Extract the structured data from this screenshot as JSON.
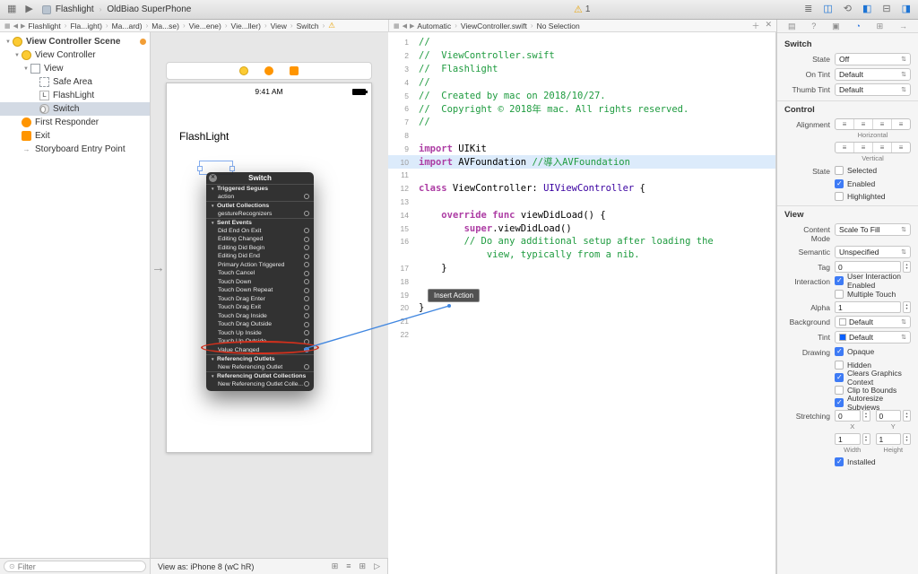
{
  "icons": {
    "chevron": "›",
    "back": "◀",
    "forward": "▶",
    "related": "▦",
    "warning": "⚠",
    "disclosure_down": "▼",
    "entry_arrow": "→",
    "close": "✕",
    "add": "＋",
    "dd_arrows": "⇅",
    "stepper_up": "▲",
    "stepper_down": "▼",
    "filter": "⊙",
    "seg": "≡",
    "list": "≣",
    "assistant": "◫",
    "version": "⟲",
    "navigator": "◧",
    "debug": "⊟",
    "inspector_panel": "◨",
    "tab_file": "▤",
    "tab_help": "?",
    "tab_identity": "▣",
    "tab_attributes": "◔",
    "tab_size": "⊞",
    "tab_connections": "→",
    "stack": "⊞",
    "align": "≡",
    "pin": "⊞",
    "resolve": "▷",
    "window": "▦",
    "play": "▶",
    "label_glyph": "L",
    "close_x": "✕"
  },
  "toolbar": {
    "scheme": "Flashlight",
    "device": "OldBiao SuperPhone",
    "warning_count": "1",
    "right_icons": [
      {
        "name": "editor-list-icon",
        "glyph": "list",
        "active": false
      },
      {
        "name": "assistant-editor-icon",
        "glyph": "assistant",
        "active": true
      },
      {
        "name": "version-editor-icon",
        "glyph": "version",
        "active": false
      },
      {
        "name": "navigator-panel-toggle",
        "glyph": "navigator",
        "active": true
      },
      {
        "name": "debug-panel-toggle",
        "glyph": "debug",
        "active": false
      },
      {
        "name": "inspector-panel-toggle",
        "glyph": "inspector_panel",
        "active": true
      }
    ]
  },
  "ib_jumpbar": {
    "items": [
      "Flashlight",
      "Fla...ight)",
      "Ma...ard)",
      "Ma...se)",
      "Vie...ene)",
      "Vie...ller)",
      "View",
      "Switch"
    ],
    "has_warning": true
  },
  "code_jumpbar": {
    "items": [
      "Automatic",
      "ViewController.swift",
      "No Selection"
    ]
  },
  "outline": {
    "scene_title": "View Controller Scene",
    "filter_placeholder": "Filter",
    "items": [
      {
        "label": "View Controller",
        "depth": 1,
        "icon": "vc",
        "disclosure": true
      },
      {
        "label": "View",
        "depth": 2,
        "icon": "view",
        "disclosure": true
      },
      {
        "label": "Safe Area",
        "depth": 3,
        "icon": "safearea"
      },
      {
        "label": "FlashLight",
        "depth": 3,
        "icon": "label"
      },
      {
        "label": "Switch",
        "depth": 3,
        "icon": "switch",
        "selected": true
      },
      {
        "label": "First Responder",
        "depth": 1,
        "icon": "fr"
      },
      {
        "label": "Exit",
        "depth": 1,
        "icon": "exit"
      },
      {
        "label": "Storyboard Entry Point",
        "depth": 1,
        "icon": "entry"
      }
    ]
  },
  "canvas": {
    "status_time": "9:41 AM",
    "app_label": "FlashLight",
    "view_as": "View as: iPhone 8 (wC hR)",
    "bottom_icons": [
      {
        "name": "embed-in-stack-button",
        "glyph": "stack"
      },
      {
        "name": "align-button",
        "glyph": "align"
      },
      {
        "name": "add-constraints-button",
        "glyph": "pin"
      },
      {
        "name": "resolve-autolayout-button",
        "glyph": "resolve"
      }
    ]
  },
  "hud": {
    "title": "Switch",
    "rows": [
      {
        "type": "section",
        "label": "Triggered Segues"
      },
      {
        "type": "item",
        "label": "action"
      },
      {
        "type": "section",
        "label": "Outlet Collections"
      },
      {
        "type": "item",
        "label": "gestureRecognizers"
      },
      {
        "type": "section",
        "label": "Sent Events"
      },
      {
        "type": "item",
        "label": "Did End On Exit"
      },
      {
        "type": "item",
        "label": "Editing Changed"
      },
      {
        "type": "item",
        "label": "Editing Did Begin"
      },
      {
        "type": "item",
        "label": "Editing Did End"
      },
      {
        "type": "item",
        "label": "Primary Action Triggered"
      },
      {
        "type": "item",
        "label": "Touch Cancel"
      },
      {
        "type": "item",
        "label": "Touch Down"
      },
      {
        "type": "item",
        "label": "Touch Down Repeat"
      },
      {
        "type": "item",
        "label": "Touch Drag Enter"
      },
      {
        "type": "item",
        "label": "Touch Drag Exit"
      },
      {
        "type": "item",
        "label": "Touch Drag Inside"
      },
      {
        "type": "item",
        "label": "Touch Drag Outside"
      },
      {
        "type": "item",
        "label": "Touch Up Inside"
      },
      {
        "type": "item",
        "label": "Touch Up Outside"
      },
      {
        "type": "item",
        "label": "Value Changed",
        "connected": true
      },
      {
        "type": "section",
        "label": "Referencing Outlets"
      },
      {
        "type": "item",
        "label": "New Referencing Outlet"
      },
      {
        "type": "section",
        "label": "Referencing Outlet Collections"
      },
      {
        "type": "item",
        "label": "New Referencing Outlet Colle..."
      }
    ]
  },
  "code": {
    "tooltip": "Insert Action",
    "lines": [
      {
        "n": "1",
        "seg": [
          [
            "com",
            "//"
          ]
        ]
      },
      {
        "n": "2",
        "seg": [
          [
            "com",
            "//  ViewController.swift"
          ]
        ]
      },
      {
        "n": "3",
        "seg": [
          [
            "com",
            "//  Flashlight"
          ]
        ]
      },
      {
        "n": "4",
        "seg": [
          [
            "com",
            "//"
          ]
        ]
      },
      {
        "n": "5",
        "seg": [
          [
            "com",
            "//  Created by mac on 2018/10/27."
          ]
        ]
      },
      {
        "n": "6",
        "seg": [
          [
            "com",
            "//  Copyright © 2018年 mac. All rights reserved."
          ]
        ]
      },
      {
        "n": "7",
        "seg": [
          [
            "com",
            "//"
          ]
        ]
      },
      {
        "n": "8",
        "seg": []
      },
      {
        "n": "9",
        "seg": [
          [
            "kw",
            "import"
          ],
          [
            "pl",
            " UIKit"
          ]
        ]
      },
      {
        "n": "10",
        "hl": true,
        "seg": [
          [
            "kw",
            "import"
          ],
          [
            "pl",
            " AVFoundation "
          ],
          [
            "com",
            "//導入AVFoundation"
          ]
        ]
      },
      {
        "n": "11",
        "seg": []
      },
      {
        "n": "12",
        "seg": [
          [
            "kw",
            "class"
          ],
          [
            "pl",
            " ViewController: "
          ],
          [
            "ty",
            "UIViewController"
          ],
          [
            "pl",
            " {"
          ]
        ]
      },
      {
        "n": "13",
        "seg": []
      },
      {
        "n": "14",
        "seg": [
          [
            "pl",
            "    "
          ],
          [
            "kw",
            "override"
          ],
          [
            "pl",
            " "
          ],
          [
            "kw",
            "func"
          ],
          [
            "pl",
            " viewDidLoad() {"
          ]
        ]
      },
      {
        "n": "15",
        "seg": [
          [
            "pl",
            "        "
          ],
          [
            "kw",
            "super"
          ],
          [
            "pl",
            ".viewDidLoad()"
          ]
        ]
      },
      {
        "n": "16",
        "seg": [
          [
            "pl",
            "        "
          ],
          [
            "com",
            "// Do any additional setup after loading the"
          ]
        ]
      },
      {
        "n": "",
        "seg": [
          [
            "pl",
            "            "
          ],
          [
            "com",
            "view, typically from a nib."
          ]
        ]
      },
      {
        "n": "17",
        "seg": [
          [
            "pl",
            "    }"
          ]
        ]
      },
      {
        "n": "18",
        "seg": []
      },
      {
        "n": "19",
        "seg": []
      },
      {
        "n": "20",
        "seg": [
          [
            "pl",
            "}"
          ]
        ]
      },
      {
        "n": "21",
        "seg": []
      },
      {
        "n": "22",
        "seg": []
      }
    ]
  },
  "inspector": {
    "tabs": [
      {
        "name": "file-inspector-tab",
        "glyph": "tab_file",
        "active": false
      },
      {
        "name": "quick-help-inspector-tab",
        "glyph": "tab_help",
        "active": false
      },
      {
        "name": "identity-inspector-tab",
        "glyph": "tab_identity",
        "active": false
      },
      {
        "name": "attributes-inspector-tab",
        "glyph": "tab_attributes",
        "active": true
      },
      {
        "name": "size-inspector-tab",
        "glyph": "tab_size",
        "active": false
      },
      {
        "name": "connections-inspector-tab",
        "glyph": "tab_connections",
        "active": false
      }
    ],
    "sections": [
      {
        "title": "Switch",
        "rows": [
          {
            "label": "State",
            "type": "dropdown",
            "value": "Off"
          },
          {
            "label": "On Tint",
            "type": "dropdown",
            "value": "Default"
          },
          {
            "label": "Thumb Tint",
            "type": "dropdown",
            "value": "Default"
          }
        ]
      },
      {
        "title": "Control",
        "rows": [
          {
            "label": "Alignment",
            "type": "segment",
            "caption": "Horizontal"
          },
          {
            "label": "",
            "type": "segment",
            "caption": "Vertical"
          },
          {
            "label": "State",
            "type": "checkbox",
            "text": "Selected",
            "checked": false
          },
          {
            "label": "",
            "type": "checkbox",
            "text": "Enabled",
            "checked": true
          },
          {
            "label": "",
            "type": "checkbox",
            "text": "Highlighted",
            "checked": false
          }
        ]
      },
      {
        "title": "View",
        "rows": [
          {
            "label": "Content Mode",
            "type": "dropdown",
            "value": "Scale To Fill"
          },
          {
            "label": "Semantic",
            "type": "dropdown",
            "value": "Unspecified"
          },
          {
            "label": "Tag",
            "type": "stepper",
            "value": "0"
          },
          {
            "label": "Interaction",
            "type": "checkbox",
            "text": "User Interaction Enabled",
            "checked": true
          },
          {
            "label": "",
            "type": "checkbox",
            "text": "Multiple Touch",
            "checked": false
          },
          {
            "label": "Alpha",
            "type": "stepper",
            "value": "1"
          },
          {
            "label": "Background",
            "type": "dropdown",
            "value": "Default",
            "swatch": "#ffffff"
          },
          {
            "label": "Tint",
            "type": "dropdown",
            "value": "Default",
            "swatch": "#0a60ff"
          },
          {
            "label": "Drawing",
            "type": "checkbox",
            "text": "Opaque",
            "checked": true
          },
          {
            "label": "",
            "type": "checkbox",
            "text": "Hidden",
            "checked": false
          },
          {
            "label": "",
            "type": "checkbox",
            "text": "Clears Graphics Context",
            "checked": true
          },
          {
            "label": "",
            "type": "checkbox",
            "text": "Clip to Bounds",
            "checked": false
          },
          {
            "label": "",
            "type": "checkbox",
            "text": "Autoresize Subviews",
            "checked": true
          },
          {
            "label": "Stretching",
            "type": "xy",
            "fields": [
              {
                "value": "0",
                "caption": "X"
              },
              {
                "value": "0",
                "caption": "Y"
              }
            ]
          },
          {
            "label": "",
            "type": "xy",
            "fields": [
              {
                "value": "1",
                "caption": "Width"
              },
              {
                "value": "1",
                "caption": "Height"
              }
            ]
          },
          {
            "label": "",
            "type": "checkbox",
            "text": "Installed",
            "checked": true
          }
        ]
      }
    ]
  }
}
